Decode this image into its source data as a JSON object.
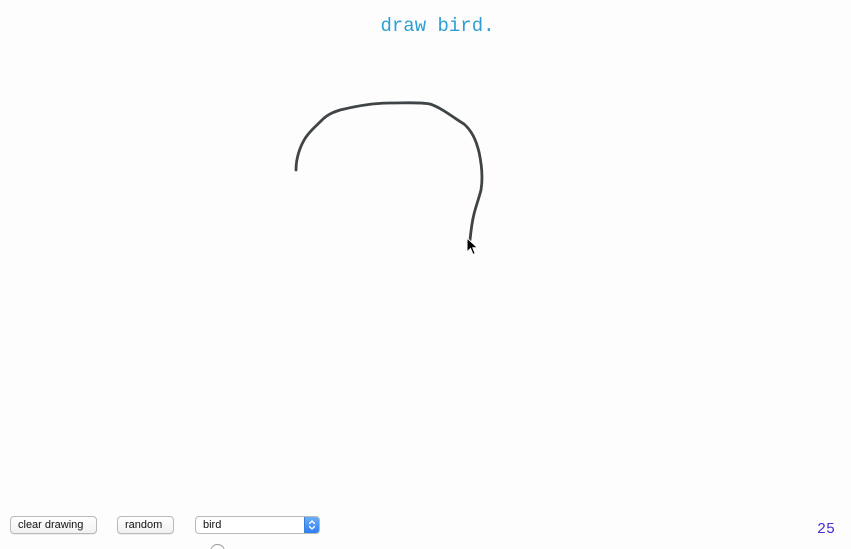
{
  "prompt": {
    "text": "draw bird."
  },
  "canvas": {
    "stroke_color": "#3f4446",
    "cursor_icon": "arrow-cursor-icon"
  },
  "toolbar": {
    "clear_label": "clear drawing",
    "random_label": "random",
    "category_select": {
      "selected": "bird",
      "arrow_icon": "updown-chevron-icon",
      "accent_color": "#2c7ff2"
    }
  },
  "counter": {
    "value": "25",
    "color": "#4a2dd6"
  },
  "colors": {
    "prompt": "#2e9fd3",
    "background": "#fdfdfd"
  }
}
